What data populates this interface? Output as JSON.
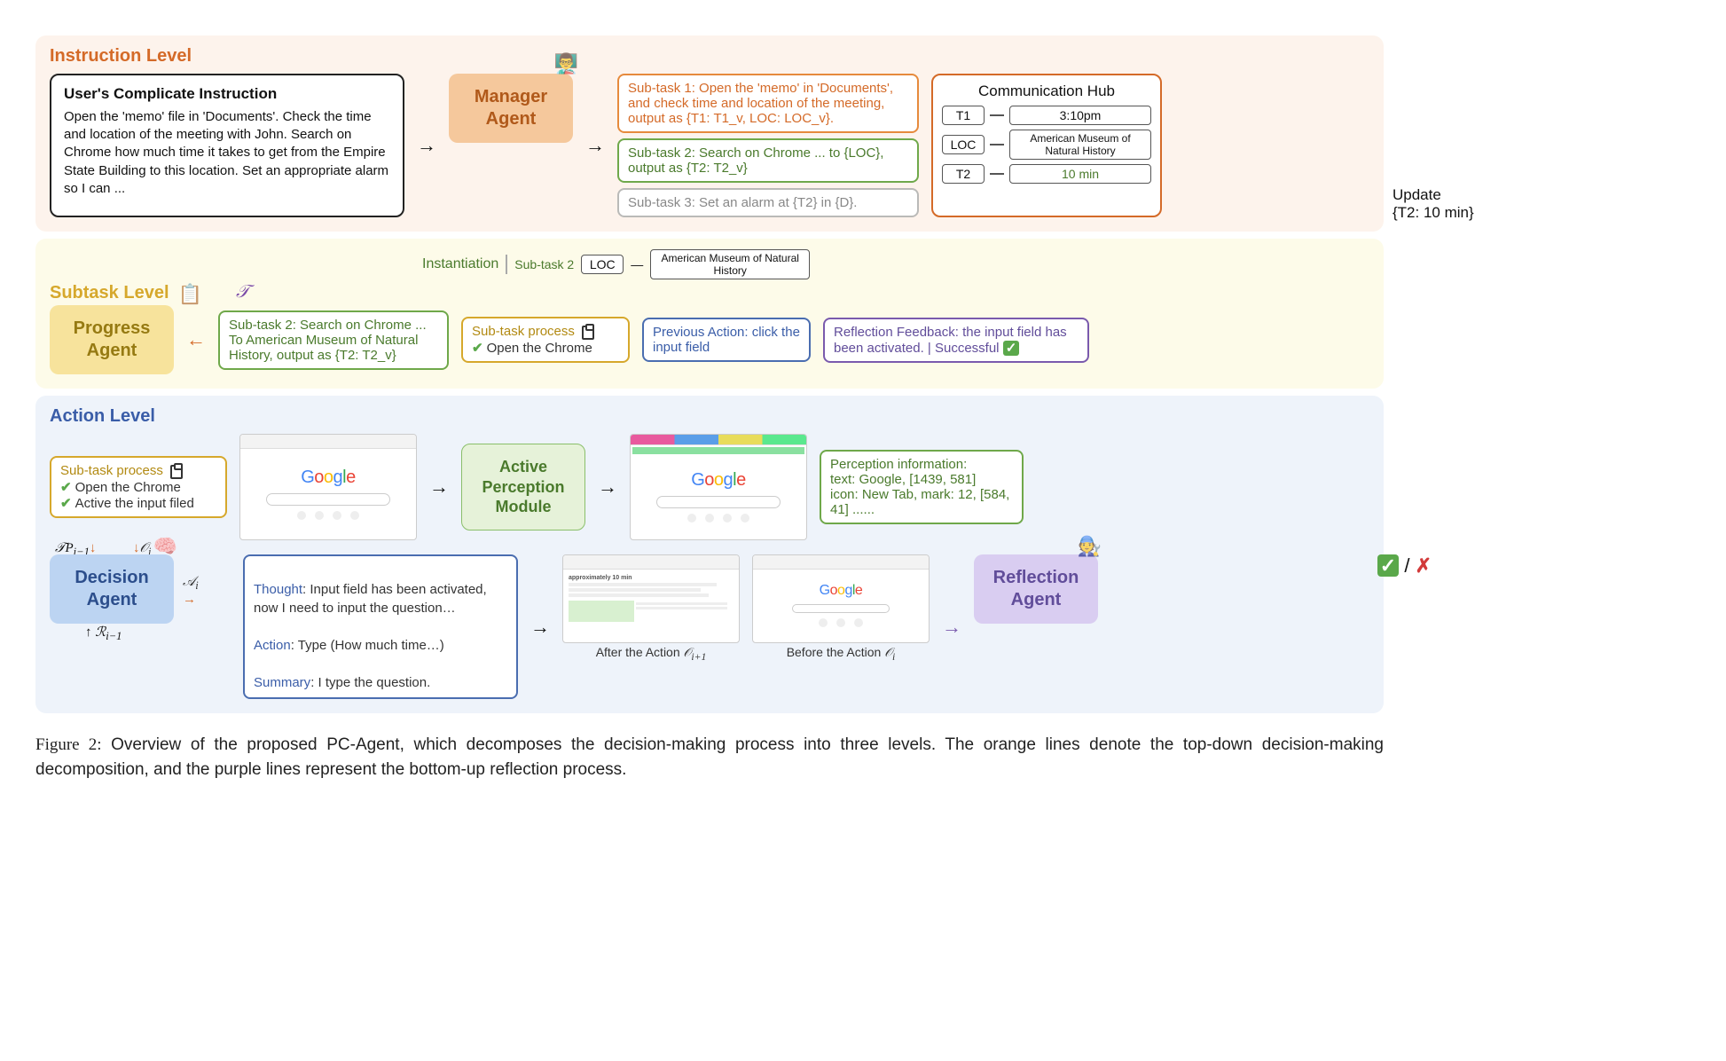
{
  "instruction": {
    "title": "Instruction Level",
    "user_card_title": "User's Complicate Instruction",
    "user_card_body": "Open the 'memo' file in 'Documents'. Check the time and location of the meeting with John. Search on Chrome how much time it takes to get from the Empire State Building to this location. Set an appropriate alarm so I can ...",
    "manager_label": "Manager\nAgent",
    "subtask1": "Sub-task 1: Open the 'memo' in 'Documents', and check time and location of the meeting, output as {T1: T1_v,  LOC: LOC_v}.",
    "subtask2": "Sub-task 2: Search on Chrome ... to {LOC}, output as {T2: T2_v}",
    "subtask3": "Sub-task 3: Set an alarm at {T2} in {D}.",
    "hub": {
      "title": "Communication Hub",
      "rows": [
        {
          "k": "T1",
          "v": "3:10pm"
        },
        {
          "k": "LOC",
          "v": "American Museum of Natural History"
        },
        {
          "k": "T2",
          "v": "10 min",
          "green": true
        }
      ]
    },
    "update_label": "Update\n{T2: 10 min}"
  },
  "subtask": {
    "title": "Subtask Level",
    "instantiation": "Instantiation",
    "inst_sub": "Sub-task 2",
    "inst_key": "LOC",
    "inst_val": "American Museum of Natural History",
    "tau": "𝒯",
    "progress_label": "Progress\nAgent",
    "progress_in": "Sub-task 2: Search on Chrome ... To American Museum of Natural History, output as {T2: T2_v}",
    "proc_title": "Sub-task process",
    "proc_item1": "Open the Chrome",
    "prev": "Previous Action: click the input field",
    "reflect": "Reflection Feedback: the input field has been activated. | Successful"
  },
  "action": {
    "title": "Action Level",
    "proc_title": "Sub-task process",
    "proc_item1": "Open the Chrome",
    "proc_item2": "Active the input filed",
    "perception_label": "Active\nPerception\nModule",
    "percep_info": "Perception information:\ntext: Google, [1439, 581]\nicon: New Tab, mark: 12, [584, 41] ......",
    "decision_label": "Decision\nAgent",
    "tp": "𝒯P",
    "tp_sub": "i−1",
    "oi": "𝒪",
    "oi_sub": "i",
    "ai": "𝒜",
    "ai_sub": "i",
    "ri": "ℛ",
    "ri_sub": "i−1",
    "thought": "Thought: Input field has been activated, now I need to input the question…\nAction: Type (How much time…)\nSummary: I type the question.",
    "reflection_label": "Reflection\nAgent",
    "after_label": "After the Action",
    "after_sym": "𝒪",
    "after_sub": "i+1",
    "before_label": "Before the Action",
    "before_sym": "𝒪",
    "before_sub": "i",
    "ok": "✓",
    "slash": " / ",
    "no": "✗"
  },
  "caption": {
    "label": "Figure 2:",
    "text": " Overview of the proposed PC-Agent, which decomposes the decision-making process into three levels. The orange lines denote the top-down decision-making decomposition, and the purple lines represent the bottom-up reflection process."
  }
}
